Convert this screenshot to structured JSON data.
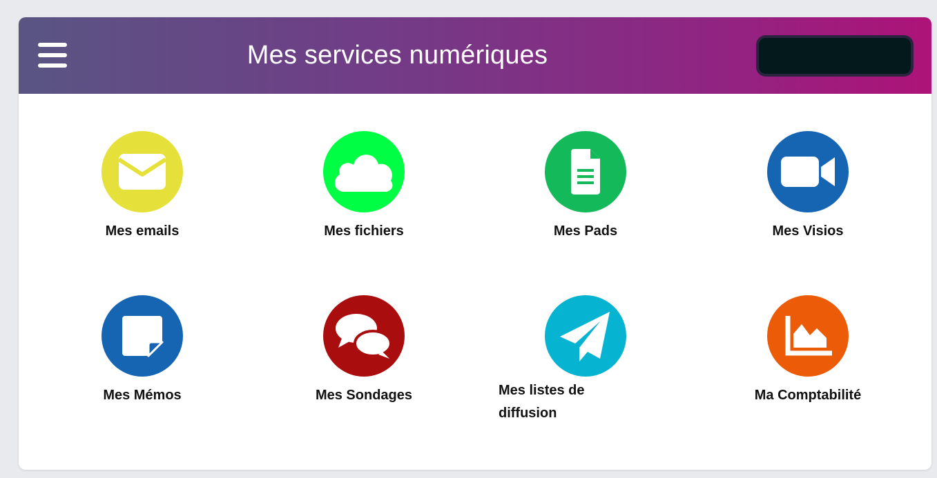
{
  "header": {
    "title": "Mes services numériques",
    "gradient": [
      "#595583",
      "#ad1378"
    ]
  },
  "services": [
    {
      "label": "Mes emails",
      "icon": "envelope-icon",
      "color": "#e6e03a"
    },
    {
      "label": "Mes fichiers",
      "icon": "cloud-icon",
      "color": "#00ff44"
    },
    {
      "label": "Mes Pads",
      "icon": "document-icon",
      "color": "#14b95a"
    },
    {
      "label": "Mes Visios",
      "icon": "video-camera-icon",
      "color": "#1665b3"
    },
    {
      "label": "Mes Mémos",
      "icon": "sticky-note-icon",
      "color": "#1665b3"
    },
    {
      "label": "Mes Sondages",
      "icon": "speech-bubbles-icon",
      "color": "#aa0d0d"
    },
    {
      "label": "Mes listes de diffusion",
      "icon": "paper-plane-icon",
      "color": "#06b3d1"
    },
    {
      "label": "Ma Comptabilité",
      "icon": "area-chart-icon",
      "color": "#ec5b08"
    }
  ]
}
